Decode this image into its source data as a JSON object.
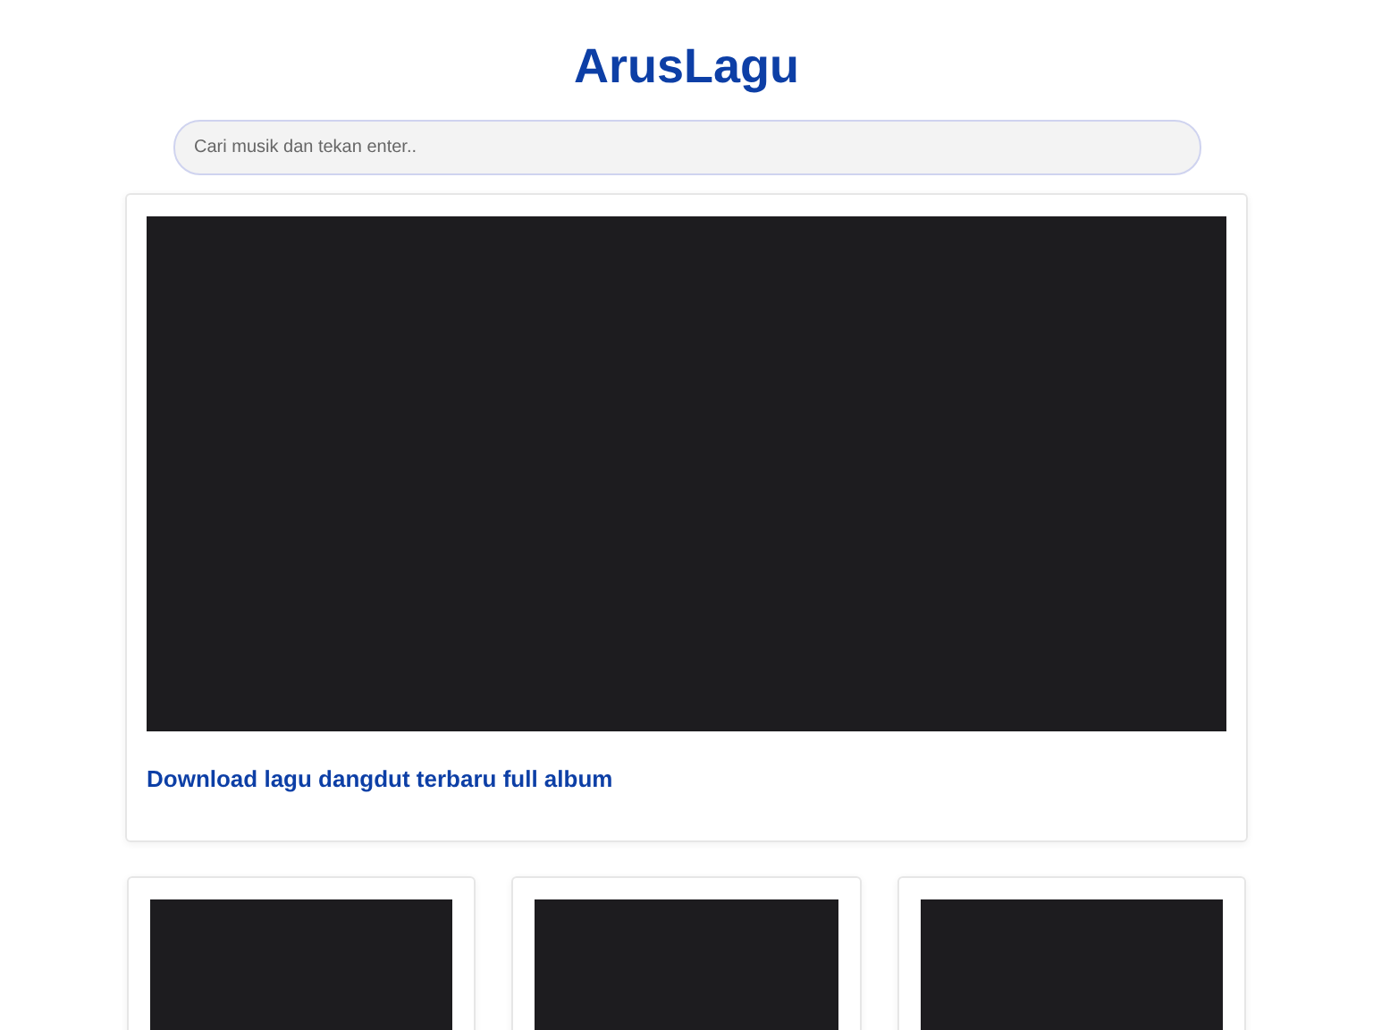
{
  "site_title": "ArusLagu",
  "search": {
    "placeholder": "Cari musik dan tekan enter.."
  },
  "featured": {
    "kind": "video",
    "title": "Download lagu dangdut terbaru full album"
  },
  "posts": [
    {
      "kind": "video"
    },
    {
      "kind": "video"
    },
    {
      "kind": "video"
    }
  ]
}
